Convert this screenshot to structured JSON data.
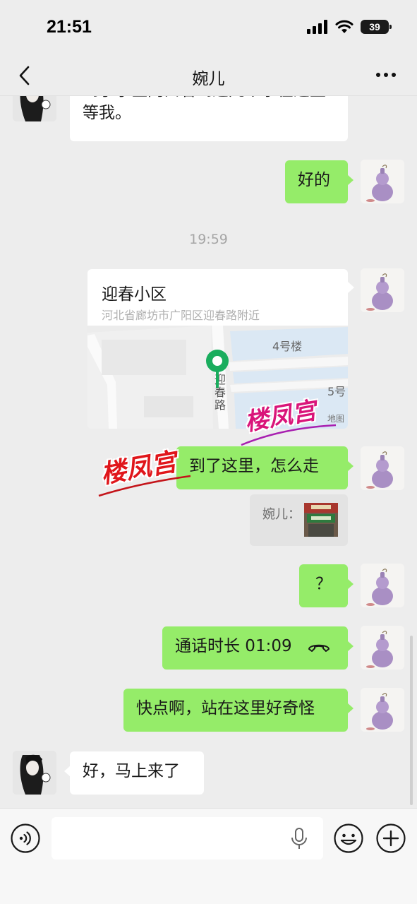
{
  "status_bar": {
    "time": "21:51",
    "battery": "39"
  },
  "nav": {
    "title": "婉儿"
  },
  "messages": {
    "m1_text": "到了小区门口看到这几个字在这里等我。",
    "m2_text": "好的",
    "timestamp": "19:59",
    "location": {
      "name": "迎春小区",
      "address": "河北省廊坊市广阳区迎春路附近",
      "map_labels": {
        "bldg4": "4号楼",
        "bldg5": "5号",
        "road": "迎春路",
        "credit": "地图"
      }
    },
    "m3_text": "到了这里，怎么走",
    "quote_text": "婉儿：",
    "m4_text": "？",
    "call_text": "通话时长 01:09",
    "m5_text": "快点啊，站在这里好奇怪",
    "m6_text": "好，马上来了"
  },
  "watermarks": {
    "top": "楼凤宫",
    "left": "楼凤宫"
  },
  "input": {
    "value": "",
    "placeholder": ""
  },
  "colors": {
    "sent_bubble": "#95ec69",
    "received_bubble": "#ffffff",
    "background": "#ededed",
    "map_pin": "#1aad5e",
    "watermark_fill": "#d9157a",
    "watermark_red": "#e0161b"
  },
  "icons": [
    "back-icon",
    "more-icon",
    "phone-hangup-icon",
    "voice-icon",
    "mic-icon",
    "emoji-icon",
    "plus-icon",
    "signal-icon",
    "wifi-icon",
    "battery-icon",
    "map-pin-icon"
  ]
}
